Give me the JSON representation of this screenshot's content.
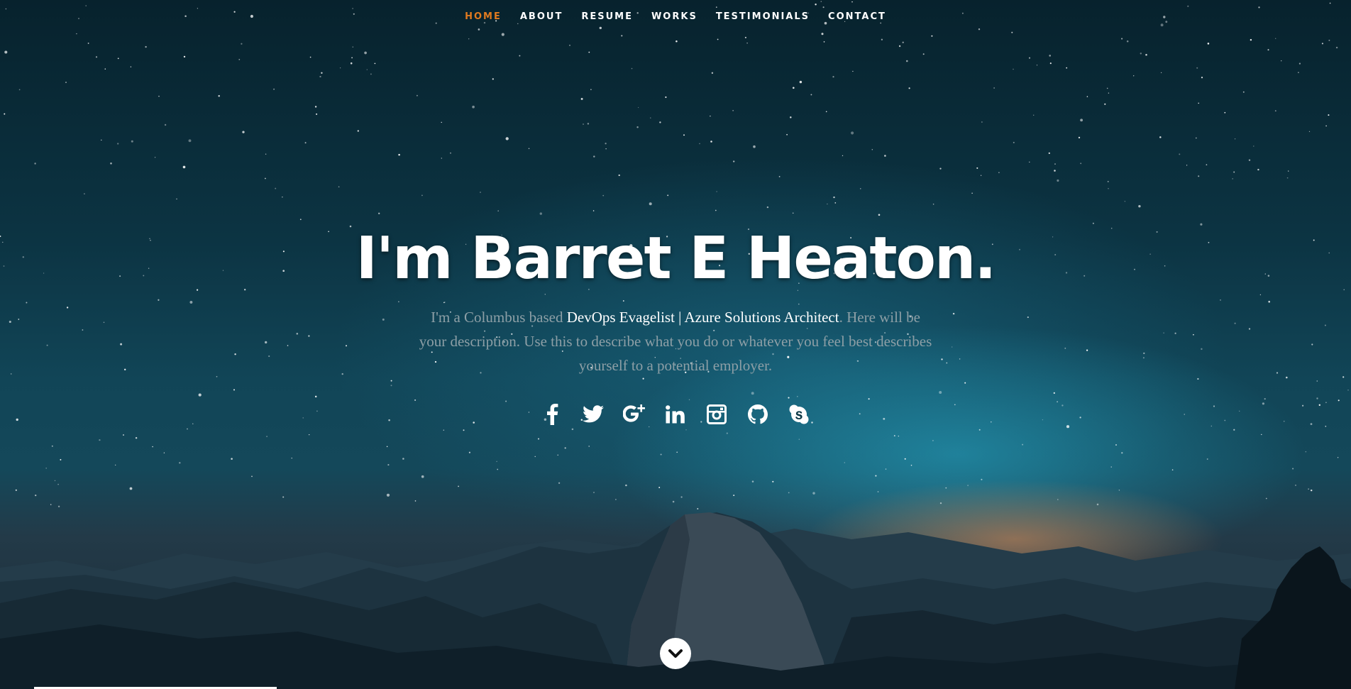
{
  "nav": {
    "items": [
      {
        "label": "HOME",
        "active": true
      },
      {
        "label": "ABOUT",
        "active": false
      },
      {
        "label": "RESUME",
        "active": false
      },
      {
        "label": "WORKS",
        "active": false
      },
      {
        "label": "TESTIMONIALS",
        "active": false
      },
      {
        "label": "CONTACT",
        "active": false
      }
    ]
  },
  "banner": {
    "headline": "I'm Barret E Heaton.",
    "desc_prefix": "I'm a Columbus based ",
    "desc_highlight": "DevOps Evagelist | Azure Solutions Architect",
    "desc_suffix": ". Here will be your description. Use this to describe what you do or whatever you feel best describes yourself to a potential employer."
  },
  "social": [
    {
      "icon": "facebook-icon"
    },
    {
      "icon": "twitter-icon"
    },
    {
      "icon": "google-plus-icon"
    },
    {
      "icon": "linkedin-icon"
    },
    {
      "icon": "instagram-icon"
    },
    {
      "icon": "github-icon"
    },
    {
      "icon": "skype-icon"
    }
  ],
  "scroll_down": {
    "icon": "chevron-down-icon"
  },
  "colors": {
    "accent": "#e07a1f",
    "text": "#ffffff",
    "muted_text": "#8d9fa6"
  }
}
